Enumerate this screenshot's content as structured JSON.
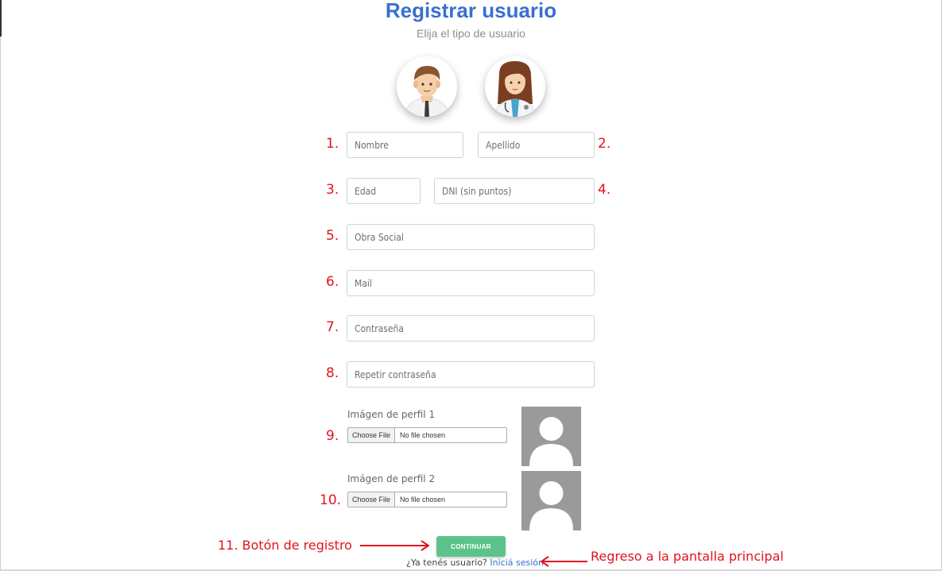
{
  "header": {
    "title": "Registrar usuario",
    "subtitle": "Elija el tipo de usuario"
  },
  "user_types": [
    {
      "name": "patient-avatar-icon"
    },
    {
      "name": "doctor-avatar-icon"
    }
  ],
  "fields": {
    "nombre": {
      "number": "1.",
      "placeholder": "Nombre",
      "value": ""
    },
    "apellido": {
      "number": "2.",
      "placeholder": "Apellido",
      "value": ""
    },
    "edad": {
      "number": "3.",
      "placeholder": "Edad",
      "value": ""
    },
    "dni": {
      "number": "4.",
      "placeholder": "DNI (sin puntos)",
      "value": ""
    },
    "obra_social": {
      "number": "5.",
      "placeholder": "Obra Social",
      "value": ""
    },
    "mail": {
      "number": "6.",
      "placeholder": "Mail",
      "value": ""
    },
    "password": {
      "number": "7.",
      "placeholder": "Contraseña",
      "value": ""
    },
    "repeat_password": {
      "number": "8.",
      "placeholder": "Repetir contraseña",
      "value": ""
    }
  },
  "profile_images": [
    {
      "number": "9.",
      "label": "Imágen de perfil 1",
      "button": "Choose File",
      "status": "No file chosen"
    },
    {
      "number": "10.",
      "label": "Imágen de perfil 2",
      "button": "Choose File",
      "status": "No file chosen"
    }
  ],
  "submit": {
    "label": "CONTINUAR"
  },
  "login": {
    "prompt": "¿Ya tenés usuario?",
    "link": "Iniciá sesión"
  },
  "annotations": {
    "submit_note": "11. Botón de registro",
    "login_note": "Regreso a la pantalla principal"
  },
  "colors": {
    "title": "#3a6fcf",
    "annotation": "#e0141e",
    "button": "#5cc48a"
  }
}
